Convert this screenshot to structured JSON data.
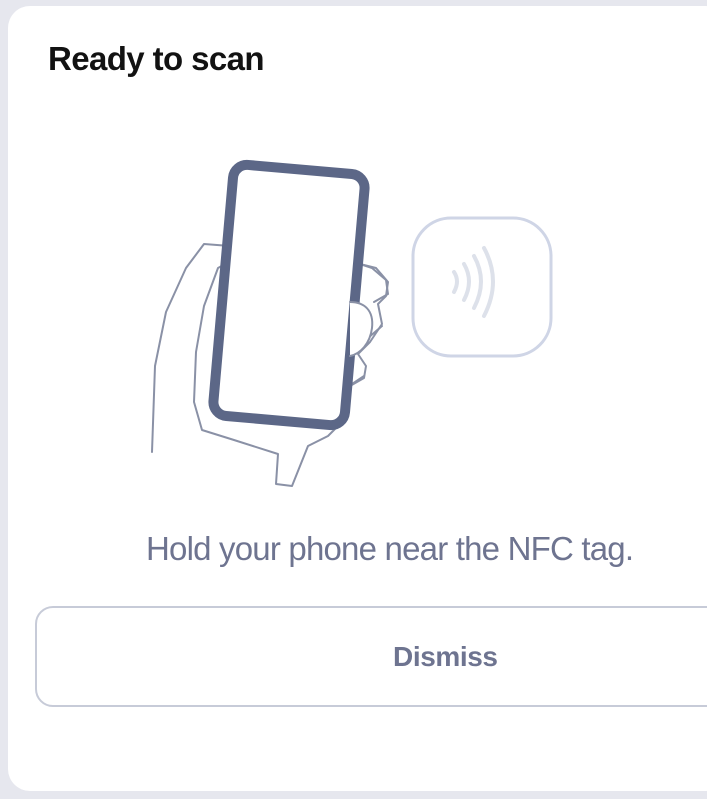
{
  "dialog": {
    "title": "Ready to scan",
    "message": "Hold your phone near the NFC tag.",
    "dismiss_label": "Dismiss"
  },
  "illustration": {
    "phone_icon": "phone-in-hand-icon",
    "tag_icon": "nfc-tag-icon"
  },
  "colors": {
    "phone_frame": "#5c6787",
    "title_text": "#121212",
    "secondary_text": "#6e7490",
    "button_border": "#c7cbd8",
    "tag_border": "#cfd5e6",
    "backdrop": "#e6e7ee"
  }
}
